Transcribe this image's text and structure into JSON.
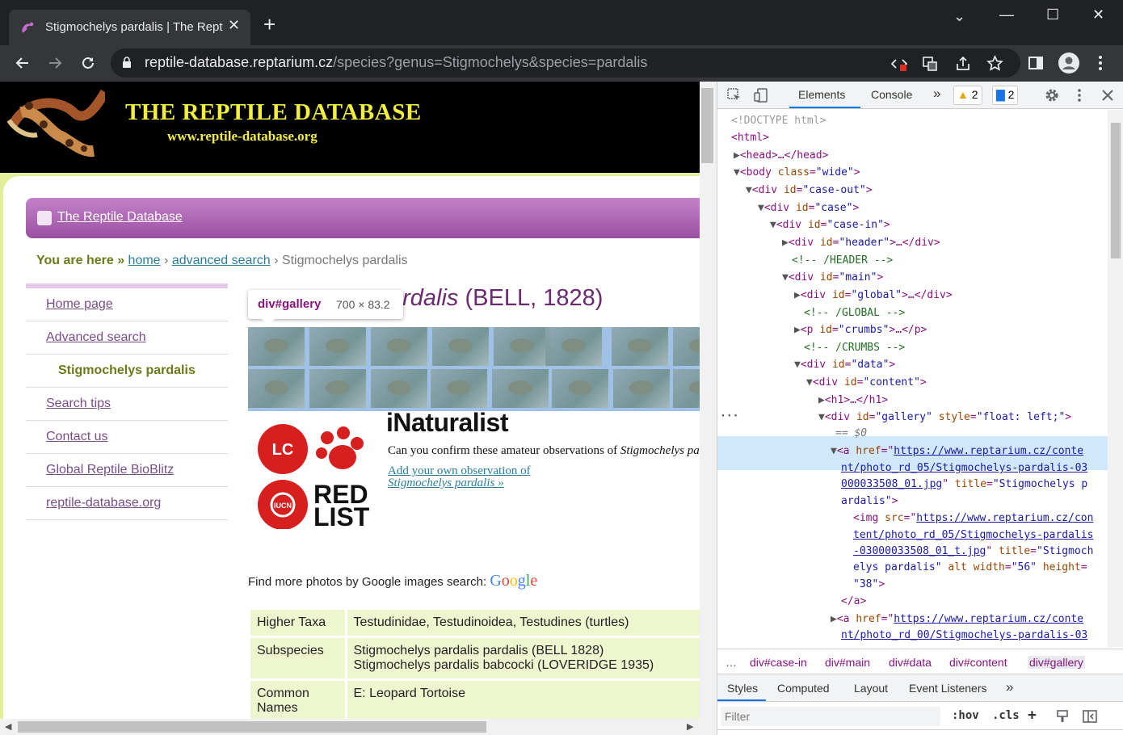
{
  "browser": {
    "tab_title": "Stigmochelys pardalis | The Reptile Database",
    "tab_close": "✕",
    "new_tab": "+",
    "url_domain": "reptile-database.reptarium.cz",
    "url_path": "/species?genus=Stigmochelys&species=pardalis",
    "window_controls": {
      "minimize": "—",
      "maximize": "☐",
      "close": "✕",
      "tabs_dropdown": "⌄"
    }
  },
  "site": {
    "title": "THE REPTILE DATABASE",
    "url": "www.reptile-database.org",
    "nav_label": "The Reptile Database",
    "crumbs": {
      "here": "You are here »",
      "home": "home",
      "sep": "›",
      "advanced": "advanced search",
      "current": "Stigmochelys pardalis"
    },
    "sidenav": [
      "Home page",
      "Advanced search",
      "Stigmochelys pardalis",
      "Search tips",
      "Contact us",
      "Global Reptile BioBlitz",
      "reptile-database.org"
    ],
    "heading_partial": "ardalis",
    "heading_author": "(BELL, 1828)",
    "tooltip": {
      "name": "div#gallery",
      "size": "700 × 83.2"
    },
    "redlist": {
      "category": "LC",
      "red": "RED",
      "list": "LIST",
      "iucn": "IUCN"
    },
    "inat": {
      "logo": "iNaturalist",
      "text": "Can you confirm these amateur observations of ",
      "text_italic": "Stigmochelys pardalis",
      "link1": "Add your own observation of",
      "link2": "Stigmochelys pardalis »"
    },
    "google": {
      "text": "Find more photos by Google images search:",
      "logo": "Google"
    },
    "taxa": [
      {
        "key": "Higher Taxa",
        "val1": "Testudinidae, Testudinoidea, Testudines (turtles)",
        "val2": ""
      },
      {
        "key": "Subspecies",
        "val1": "Stigmochelys pardalis pardalis (BELL 1828)",
        "val2": "Stigmochelys pardalis babcocki (LOVERIDGE 1935)"
      },
      {
        "key": "Common Names",
        "val1": "E: Leopard Tortoise",
        "val2": ""
      }
    ]
  },
  "devtools": {
    "tabs": [
      "Elements",
      "Console",
      "»"
    ],
    "warnings": "2",
    "messages": "2",
    "dom": {
      "doctype": "<!DOCTYPE html>",
      "html": "<html>",
      "head": "<head>…</head>",
      "body_open": "<body ",
      "body_attr": "class",
      "body_val": "\"wide\"",
      "case_out": "\"case-out\"",
      "case": "\"case\"",
      "case_in": "\"case-in\"",
      "header": "\"header\"",
      "header_comment": "<!-- /HEADER -->",
      "main": "\"main\"",
      "global": "\"global\"",
      "global_comment": "<!-- /GLOBAL -->",
      "crumbs": "\"crumbs\"",
      "crumbs_comment": "<!-- /CRUMBS -->",
      "data": "\"data\"",
      "content": "\"content\"",
      "h1": "<h1>…</h1>",
      "gallery": "\"gallery\"",
      "gallery_style": "\"float: left;\"",
      "eq": "== $0",
      "href1a": "https://www.reptarium.cz/conte",
      "href1b": "nt/photo_rd_05/Stigmochelys-pardalis-03",
      "href1c": "000033508_01.jpg",
      "title1a": "\"Stigmochelys p",
      "title1b": "ardalis\"",
      "src1a": "https://www.reptarium.cz/con",
      "src1b": "tent/photo_rd_05/Stigmochelys-pardalis",
      "src1c": "-03000033508_01_t.jpg",
      "title2a": "\"Stigmoch",
      "title2b": "elys pardalis\"",
      "width": "\"56\"",
      "height": "\"38\"",
      "close_a": "</a>",
      "href2a": "https://www.reptarium.cz/conte",
      "href2b": "nt/photo_rd_00/Stigmochelys-pardalis-03"
    },
    "breadcrumb": [
      "…",
      "div#case-in",
      "div#main",
      "div#data",
      "div#content",
      "div#gallery"
    ],
    "style_tabs": [
      "Styles",
      "Computed",
      "Layout",
      "Event Listeners",
      "»"
    ],
    "filter_placeholder": "Filter",
    "hov": ":hov",
    "cls": ".cls"
  }
}
